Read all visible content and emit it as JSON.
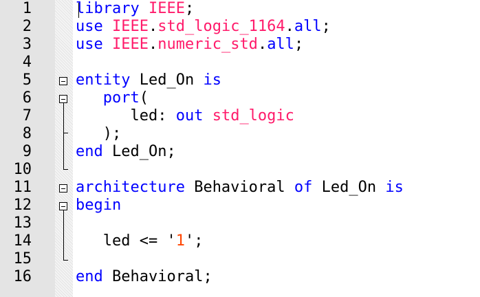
{
  "editor": {
    "language": "VHDL",
    "colors": {
      "keyword": "#0000ff",
      "type_library": "#ff1a6a",
      "literal": "#ff4500",
      "plain": "#000000",
      "gutter_bg": "#e4e4e4"
    },
    "lines": [
      {
        "num": "1",
        "tokens": [
          {
            "t": "library",
            "c": "k"
          },
          {
            "t": " "
          },
          {
            "t": "IEEE",
            "c": "r"
          },
          {
            "t": ";"
          }
        ]
      },
      {
        "num": "2",
        "tokens": [
          {
            "t": "use",
            "c": "k"
          },
          {
            "t": " "
          },
          {
            "t": "IEEE",
            "c": "r"
          },
          {
            "t": "."
          },
          {
            "t": "std_logic_1164",
            "c": "r"
          },
          {
            "t": "."
          },
          {
            "t": "all",
            "c": "k"
          },
          {
            "t": ";"
          }
        ]
      },
      {
        "num": "3",
        "tokens": [
          {
            "t": "use",
            "c": "k"
          },
          {
            "t": " "
          },
          {
            "t": "IEEE",
            "c": "r"
          },
          {
            "t": "."
          },
          {
            "t": "numeric_std",
            "c": "r"
          },
          {
            "t": "."
          },
          {
            "t": "all",
            "c": "k"
          },
          {
            "t": ";"
          }
        ]
      },
      {
        "num": "4",
        "tokens": []
      },
      {
        "num": "5",
        "tokens": [
          {
            "t": "entity",
            "c": "k"
          },
          {
            "t": " Led_On "
          },
          {
            "t": "is",
            "c": "k"
          }
        ]
      },
      {
        "num": "6",
        "tokens": [
          {
            "t": "   "
          },
          {
            "t": "port",
            "c": "k"
          },
          {
            "t": "("
          }
        ]
      },
      {
        "num": "7",
        "tokens": [
          {
            "t": "      led: "
          },
          {
            "t": "out",
            "c": "k"
          },
          {
            "t": " "
          },
          {
            "t": "std_logic",
            "c": "r"
          }
        ]
      },
      {
        "num": "8",
        "tokens": [
          {
            "t": "   );"
          }
        ]
      },
      {
        "num": "9",
        "tokens": [
          {
            "t": "end",
            "c": "k"
          },
          {
            "t": " Led_On;"
          }
        ]
      },
      {
        "num": "10",
        "tokens": []
      },
      {
        "num": "11",
        "tokens": [
          {
            "t": "architecture",
            "c": "k"
          },
          {
            "t": " Behavioral "
          },
          {
            "t": "of",
            "c": "k"
          },
          {
            "t": " Led_On "
          },
          {
            "t": "is",
            "c": "k"
          }
        ]
      },
      {
        "num": "12",
        "tokens": [
          {
            "t": "begin",
            "c": "k"
          }
        ]
      },
      {
        "num": "13",
        "tokens": []
      },
      {
        "num": "14",
        "tokens": [
          {
            "t": "   led <= '"
          },
          {
            "t": "1",
            "c": "l"
          },
          {
            "t": "';"
          }
        ]
      },
      {
        "num": "15",
        "tokens": []
      },
      {
        "num": "16",
        "tokens": [
          {
            "t": "end",
            "c": "k"
          },
          {
            "t": " Behavioral;"
          }
        ]
      }
    ]
  }
}
